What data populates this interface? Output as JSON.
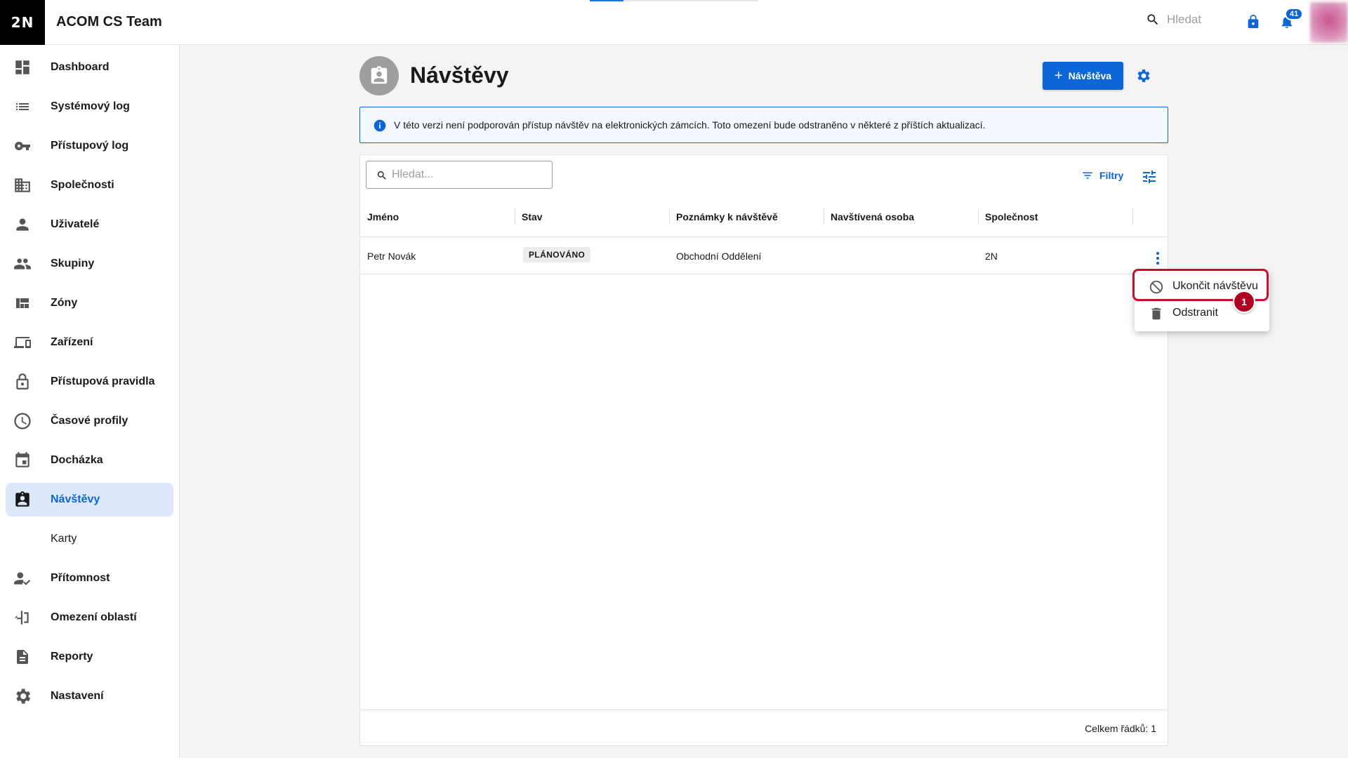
{
  "app": {
    "logo": "2N",
    "title": "ACOM CS Team"
  },
  "topbar": {
    "search_label": "Hledat",
    "notification_count": "41",
    "search_icon": "search-icon",
    "lock_icon": "lock-icon",
    "bell_icon": "bell-icon"
  },
  "sidebar": {
    "items": [
      {
        "label": "Dashboard",
        "icon": "dashboard-icon"
      },
      {
        "label": "Systémový log",
        "icon": "list-icon"
      },
      {
        "label": "Přístupový log",
        "icon": "key-icon"
      },
      {
        "label": "Společnosti",
        "icon": "building-icon"
      },
      {
        "label": "Uživatelé",
        "icon": "person-icon"
      },
      {
        "label": "Skupiny",
        "icon": "group-icon"
      },
      {
        "label": "Zóny",
        "icon": "zones-icon"
      },
      {
        "label": "Zařízení",
        "icon": "devices-icon"
      },
      {
        "label": "Přístupová pravidla",
        "icon": "lock-open-icon"
      },
      {
        "label": "Časové profily",
        "icon": "clock-icon"
      },
      {
        "label": "Docházka",
        "icon": "calendar-icon"
      },
      {
        "label": "Návštěvy",
        "icon": "visitor-badge-icon",
        "active": true
      },
      {
        "label": "Karty",
        "sub": true
      },
      {
        "label": "Přítomnost",
        "icon": "person-check-icon"
      },
      {
        "label": "Omezení oblastí",
        "icon": "area-limit-icon"
      },
      {
        "label": "Reporty",
        "icon": "report-icon"
      },
      {
        "label": "Nastavení",
        "icon": "gear-icon"
      }
    ]
  },
  "page": {
    "title": "Návštěvy",
    "add_button": "Návštěva",
    "info_text": "V této verzi není podporován přístup návštěv na elektronických zámcích. Toto omezení bude odstraněno v některé z příštích aktualizací."
  },
  "table": {
    "search_placeholder": "Hledat...",
    "filters_label": "Filtry",
    "columns": [
      "Jméno",
      "Stav",
      "Poznámky k návštěvě",
      "Navštívená osoba",
      "Společnost"
    ],
    "rows": [
      {
        "name": "Petr Novák",
        "status": "PLÁNOVÁNO",
        "notes": "Obchodní Oddělení",
        "visited_person": "",
        "company": "2N"
      }
    ],
    "footer": "Celkem řádků: 1"
  },
  "context_menu": {
    "items": [
      {
        "label": "Ukončit návštěvu",
        "icon": "block-icon"
      },
      {
        "label": "Odstranit",
        "icon": "trash-icon"
      }
    ],
    "step_badge": "1"
  },
  "colors": {
    "primary": "#0c66d6",
    "active_bg": "#dde8fb",
    "highlight": "#c8102e"
  }
}
